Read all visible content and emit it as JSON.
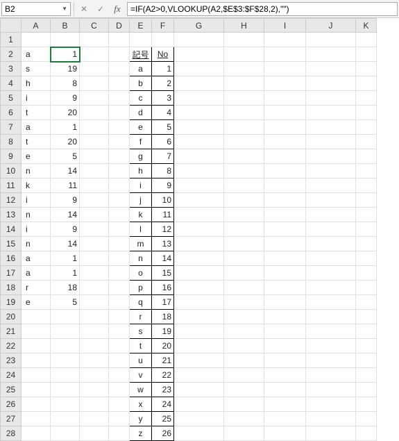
{
  "name_box": "B2",
  "formula": "=IF(A2>0,VLOOKUP(A2,$E$3:$F$28,2),\"\")",
  "columns": [
    "A",
    "B",
    "C",
    "D",
    "E",
    "F",
    "G",
    "H",
    "I",
    "J",
    "K"
  ],
  "rows": 28,
  "selected_cell": "B2",
  "lookup_header": {
    "symbol": "記号",
    "number": "No"
  },
  "data_ab": [
    {
      "a": "a",
      "b": "1"
    },
    {
      "a": "s",
      "b": "19"
    },
    {
      "a": "h",
      "b": "8"
    },
    {
      "a": "i",
      "b": "9"
    },
    {
      "a": "t",
      "b": "20"
    },
    {
      "a": "a",
      "b": "1"
    },
    {
      "a": "t",
      "b": "20"
    },
    {
      "a": "e",
      "b": "5"
    },
    {
      "a": "n",
      "b": "14"
    },
    {
      "a": "k",
      "b": "11"
    },
    {
      "a": "i",
      "b": "9"
    },
    {
      "a": "n",
      "b": "14"
    },
    {
      "a": "i",
      "b": "9"
    },
    {
      "a": "n",
      "b": "14"
    },
    {
      "a": "a",
      "b": "1"
    },
    {
      "a": "a",
      "b": "1"
    },
    {
      "a": "r",
      "b": "18"
    },
    {
      "a": "e",
      "b": "5"
    }
  ],
  "data_ef": [
    {
      "e": "a",
      "f": "1"
    },
    {
      "e": "b",
      "f": "2"
    },
    {
      "e": "c",
      "f": "3"
    },
    {
      "e": "d",
      "f": "4"
    },
    {
      "e": "e",
      "f": "5"
    },
    {
      "e": "f",
      "f": "6"
    },
    {
      "e": "g",
      "f": "7"
    },
    {
      "e": "h",
      "f": "8"
    },
    {
      "e": "i",
      "f": "9"
    },
    {
      "e": "j",
      "f": "10"
    },
    {
      "e": "k",
      "f": "11"
    },
    {
      "e": "l",
      "f": "12"
    },
    {
      "e": "m",
      "f": "13"
    },
    {
      "e": "n",
      "f": "14"
    },
    {
      "e": "o",
      "f": "15"
    },
    {
      "e": "p",
      "f": "16"
    },
    {
      "e": "q",
      "f": "17"
    },
    {
      "e": "r",
      "f": "18"
    },
    {
      "e": "s",
      "f": "19"
    },
    {
      "e": "t",
      "f": "20"
    },
    {
      "e": "u",
      "f": "21"
    },
    {
      "e": "v",
      "f": "22"
    },
    {
      "e": "w",
      "f": "23"
    },
    {
      "e": "x",
      "f": "24"
    },
    {
      "e": "y",
      "f": "25"
    },
    {
      "e": "z",
      "f": "26"
    }
  ]
}
